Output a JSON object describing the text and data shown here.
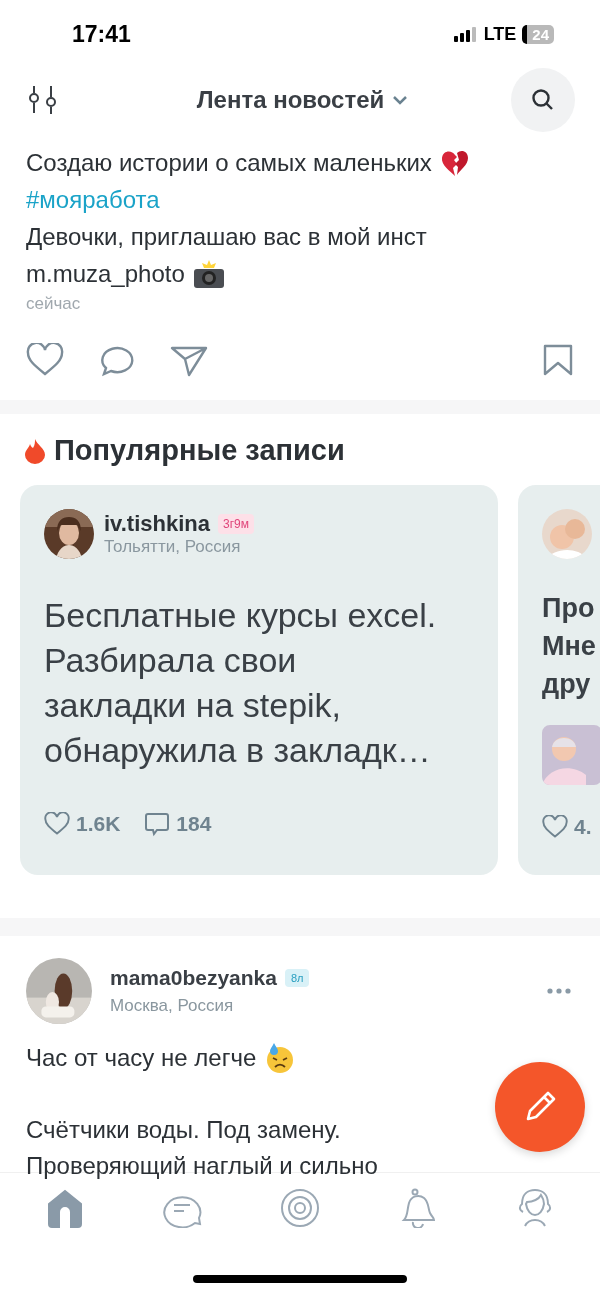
{
  "status_bar": {
    "time": "17:41",
    "network": "LTE",
    "battery": "24"
  },
  "header": {
    "title": "Лента новостей"
  },
  "post": {
    "lines": [
      {
        "kind": "text",
        "text": "Создаю истории о самых маленьких"
      },
      {
        "kind": "hashtag",
        "text": "#мояработа"
      },
      {
        "kind": "text",
        "text": "Девочки, приглашаю вас в мой инст"
      },
      {
        "kind": "text",
        "text": "m.muza_photo"
      }
    ],
    "time": "сейчас"
  },
  "popular": {
    "title": "Популярные записи",
    "cards": [
      {
        "author": "iv.tishkina",
        "badge": "3г9м",
        "color": "#fde0e8",
        "location": "Тольятти, Россия",
        "text": "Бесплатные курсы excel. Разбирала свои закладки на stepik, обнаружила в закладк…",
        "likes": "1.6K",
        "comments": "184"
      },
      {
        "lines": [
          "Про",
          "Мне",
          "дру"
        ],
        "likes": "4."
      }
    ]
  },
  "feed_post": {
    "author": "mama0bezyanka",
    "badge": "8л",
    "color": "#d9f1f7",
    "location": "Москва, Россия",
    "paragraphs": [
      {
        "text": "Час от часу не легче"
      },
      {
        "text": "Счётчики воды. Под замену."
      },
      {
        "text": "Проверяющий наглый и сильно"
      }
    ]
  },
  "tab_bar": [
    {
      "selected": true
    },
    {
      "selected": false
    },
    {
      "selected": false
    },
    {
      "selected": false
    },
    {
      "selected": false
    }
  ]
}
